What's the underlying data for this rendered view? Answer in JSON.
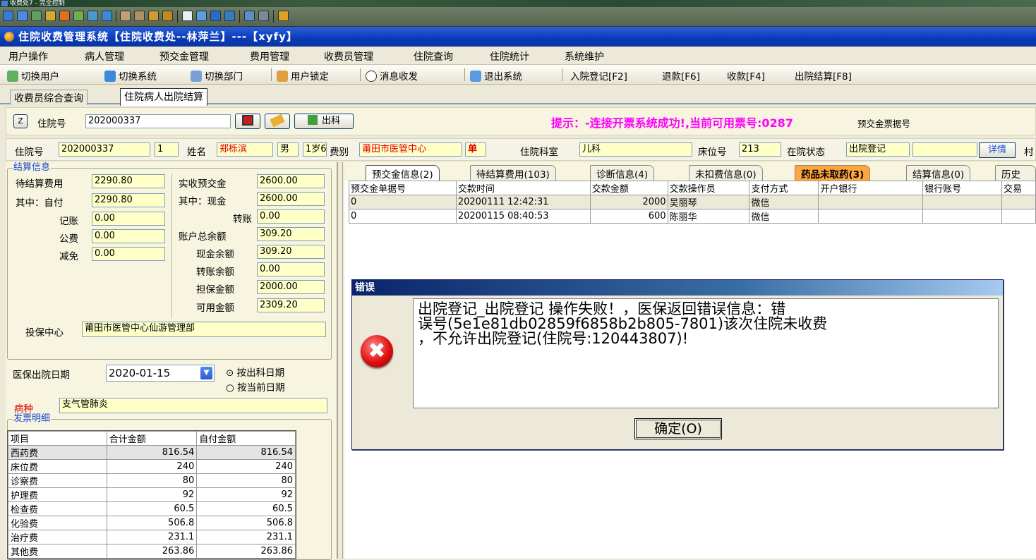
{
  "outer": {
    "title": "收费处7 - 完全控制"
  },
  "app": {
    "title": "住院收费管理系统【住院收费处--林萍兰】---【xyfy】"
  },
  "menu": [
    "用户操作",
    "病人管理",
    "预交金管理",
    "费用管理",
    "收费员管理",
    "住院查询",
    "住院统计",
    "系统维护"
  ],
  "commands": {
    "switch_user": "切换用户",
    "switch_system": "切换系统",
    "switch_dept": "切换部门",
    "lock_user": "用户锁定",
    "message": "消息收发",
    "exit": "退出系统",
    "admit": "入院登记[F2]",
    "refund": "退款[F6]",
    "collect": "收款[F4]",
    "discharge": "出院结算[F8]"
  },
  "page_tabs": [
    "收费员综合查询",
    "住院病人出院结算"
  ],
  "search": {
    "z_label": "Z",
    "hosp_no_label": "住院号",
    "hosp_no_value": "202000337",
    "discharge_btn": "出科",
    "hint": "提示：-连接开票系统成功!,当前可用票号:0287",
    "hint_tail": "预交金票据号"
  },
  "info": {
    "hosp_no_label": "住院号",
    "hosp_no": "202000337",
    "visit": "1",
    "name_label": "姓名",
    "name": "郑栎滨",
    "sex": "男",
    "age": "1岁6",
    "fee_label": "费别",
    "fee_type": "莆田市医管中心",
    "fee_flag": "单",
    "dept_label": "住院科室",
    "dept": "儿科",
    "bed_label": "床位号",
    "bed": "213",
    "status_label": "在院状态",
    "status": "出院登记",
    "detail": "详情",
    "tail": "村"
  },
  "settle": {
    "title": "结算信息",
    "pending_label": "待结算费用",
    "pending": "2290.80",
    "self_label": "其中：自付",
    "self": "2290.80",
    "account_label": "记账",
    "account": "0.00",
    "public_label": "公费",
    "public": "0.00",
    "exempt_label": "减免",
    "exempt": "0.00",
    "received_label": "实收预交金",
    "received": "2600.00",
    "cash_label": "其中：现金",
    "cash": "2600.00",
    "transfer_label": "转账",
    "transfer": "0.00",
    "balance_label": "账户总余额",
    "balance": "309.20",
    "cash_bal_label": "现金余额",
    "cash_bal": "309.20",
    "transfer_bal_label": "转账余额",
    "transfer_bal": "0.00",
    "guarantee_label": "担保金额",
    "guarantee": "2000.00",
    "available_label": "可用金额",
    "available": "2309.20",
    "insurer_label": "投保中心",
    "insurer": "莆田市医管中心仙游管理部",
    "date_label": "医保出院日期",
    "date": "2020-01-15",
    "radio1": "按出科日期",
    "radio2": "按当前日期",
    "disease_label": "病种",
    "disease": "支气管肺炎"
  },
  "invoice": {
    "title": "发票明细",
    "headers": [
      "项目",
      "合计金额",
      "自付金额"
    ],
    "rows": [
      [
        "西药费",
        "816.54",
        "816.54"
      ],
      [
        "床位费",
        "240",
        "240"
      ],
      [
        "诊察费",
        "80",
        "80"
      ],
      [
        "护理费",
        "92",
        "92"
      ],
      [
        "检查费",
        "60.5",
        "60.5"
      ],
      [
        "化验费",
        "506.8",
        "506.8"
      ],
      [
        "治疗费",
        "231.1",
        "231.1"
      ],
      [
        "其他费",
        "263.86",
        "263.86"
      ]
    ]
  },
  "right_tabs": [
    "预交金信息(2)",
    "待结算费用(103)",
    "诊断信息(4)",
    "未扣费信息(0)",
    "药品未取药(3)",
    "结算信息(0)",
    "历史"
  ],
  "deposit_grid": {
    "headers": [
      "预交金单据号",
      "交款时间",
      "交款金额",
      "交款操作员",
      "支付方式",
      "开户银行",
      "银行账号",
      "交易"
    ],
    "rows": [
      [
        "0",
        "20200111 12:42:31",
        "2000",
        "吴丽琴",
        "微信",
        "",
        "",
        ""
      ],
      [
        "0",
        "20200115 08:40:53",
        "600",
        "陈丽华",
        "微信",
        "",
        "",
        ""
      ]
    ]
  },
  "dialog": {
    "title": "错误",
    "message_lines": [
      "出院登记_出院登记 操作失败！，医保返回错误信息：错",
      "误号(5e1e81db02859f6858b2b805-7801)该次住院未收费",
      "，不允许出院登记(住院号:120443807)!"
    ],
    "ok": "确定(O)"
  }
}
